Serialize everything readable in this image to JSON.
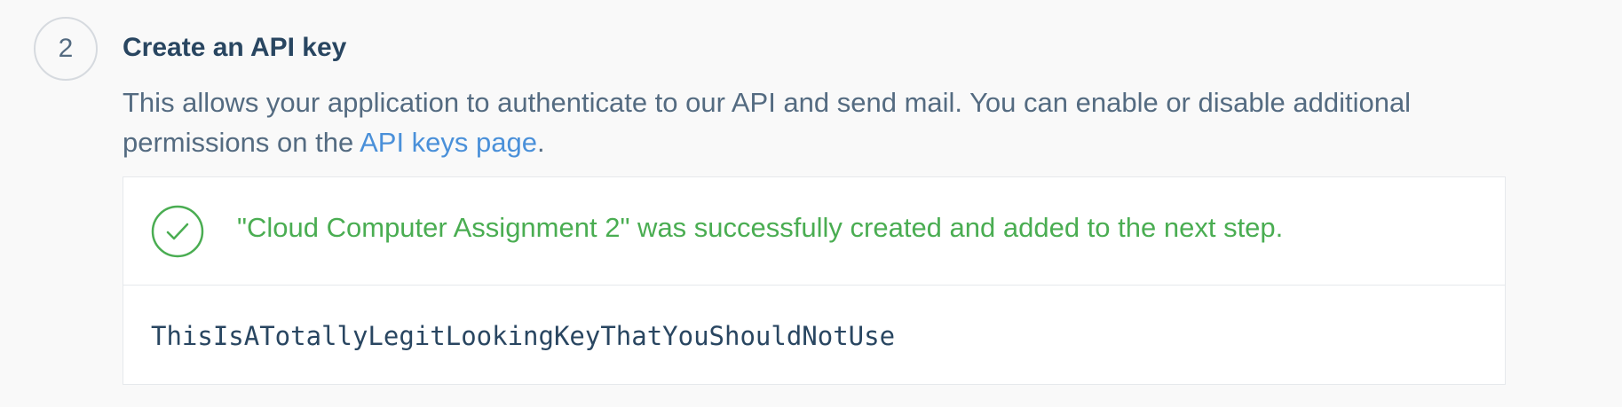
{
  "step": {
    "number": "2",
    "title": "Create an API key",
    "description_before": "This allows your application to authenticate to our API and send mail. You can enable or disable additional permissions on the ",
    "description_link": "API keys page",
    "description_after": "."
  },
  "result": {
    "success_message": "\"Cloud Computer Assignment 2\" was successfully created and added to the next step.",
    "api_key": "ThisIsATotallyLegitLookingKeyThatYouShouldNotUse",
    "icon": "check-circle-icon"
  },
  "colors": {
    "success": "#4aad52",
    "link": "#4a90d9",
    "heading": "#294661",
    "body_text": "#546b81",
    "border": "#e6e9ec"
  }
}
